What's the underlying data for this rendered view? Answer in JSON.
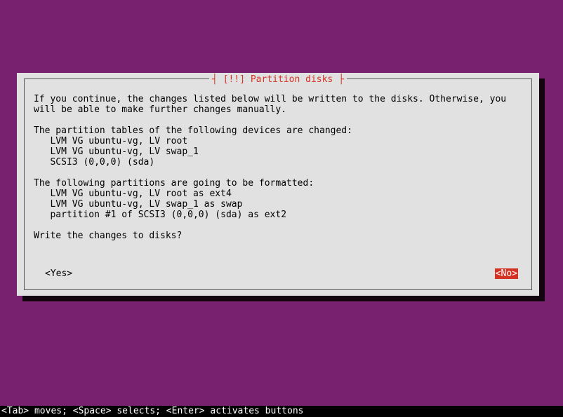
{
  "dialog": {
    "title": "[!!] Partition disks",
    "intro": "If you continue, the changes listed below will be written to the disks. Otherwise, you will be able to make further changes manually.",
    "tables_heading": "The partition tables of the following devices are changed:",
    "tables_entries": [
      "LVM VG ubuntu-vg, LV root",
      "LVM VG ubuntu-vg, LV swap_1",
      "SCSI3 (0,0,0) (sda)"
    ],
    "format_heading": "The following partitions are going to be formatted:",
    "format_entries": [
      "LVM VG ubuntu-vg, LV root as ext4",
      "LVM VG ubuntu-vg, LV swap_1 as swap",
      "partition #1 of SCSI3 (0,0,0) (sda) as ext2"
    ],
    "prompt": "Write the changes to disks?",
    "yes_label": "<Yes>",
    "no_label": "<No>"
  },
  "footer": {
    "text": "<Tab> moves; <Space> selects; <Enter> activates buttons"
  }
}
